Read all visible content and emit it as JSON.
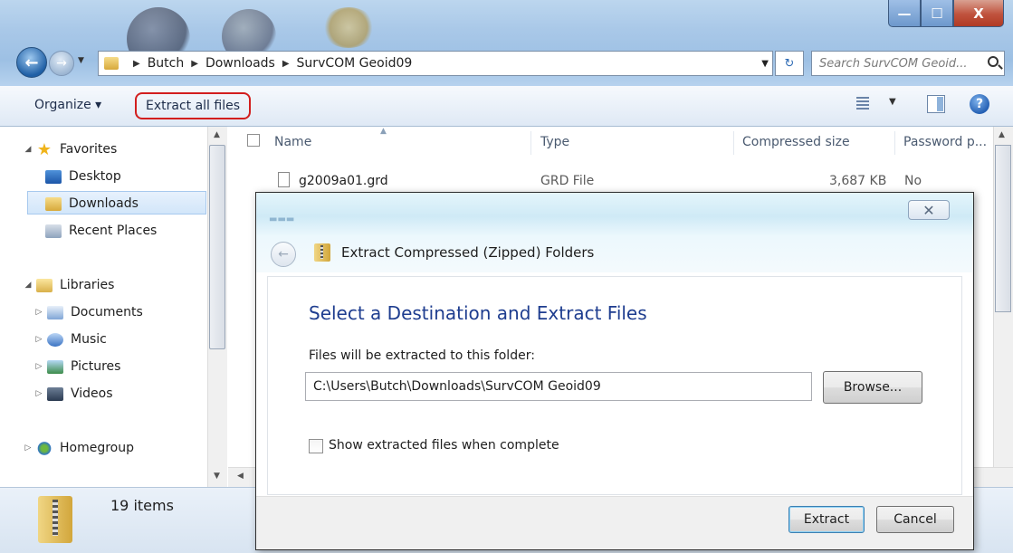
{
  "window": {
    "controls": {
      "minimize": "—",
      "maximize": "☐",
      "close": "X"
    }
  },
  "address_bar": {
    "breadcrumbs": [
      "Butch",
      "Downloads",
      "SurvCOM Geoid09"
    ]
  },
  "search": {
    "placeholder": "Search SurvCOM Geoid...  "
  },
  "toolbar": {
    "organize_label": "Organize ▾",
    "extract_all_label": "Extract all files",
    "help_label": "?"
  },
  "nav_pane": {
    "favorites": {
      "label": "Favorites",
      "items": [
        "Desktop",
        "Downloads",
        "Recent Places"
      ],
      "selected": "Downloads"
    },
    "libraries": {
      "label": "Libraries",
      "items": [
        "Documents",
        "Music",
        "Pictures",
        "Videos"
      ]
    },
    "homegroup": {
      "label": "Homegroup"
    }
  },
  "file_list": {
    "columns": [
      "Name",
      "Type",
      "Compressed size",
      "Password p..."
    ],
    "rows": [
      {
        "name": "g2009a01.grd",
        "type": "GRD File",
        "compressed_size": "3,687 KB",
        "password": "No"
      }
    ]
  },
  "status_bar": {
    "item_count": "19 items"
  },
  "dialog": {
    "title": "Extract Compressed (Zipped) Folders",
    "close_glyph": "✕",
    "back_glyph": "←",
    "heading": "Select a Destination and Extract Files",
    "folder_label": "Files will be extracted to this folder:",
    "destination_path": "C:\\Users\\Butch\\Downloads\\SurvCOM Geoid09",
    "browse_label": "Browse...",
    "show_files_label": "Show extracted files when complete",
    "show_files_checked": false,
    "extract_label": "Extract",
    "cancel_label": "Cancel"
  },
  "colors": {
    "extract_highlight": "#d21e1e",
    "dialog_heading": "#1e3d8f",
    "title_bar": "#a9c8e8"
  }
}
